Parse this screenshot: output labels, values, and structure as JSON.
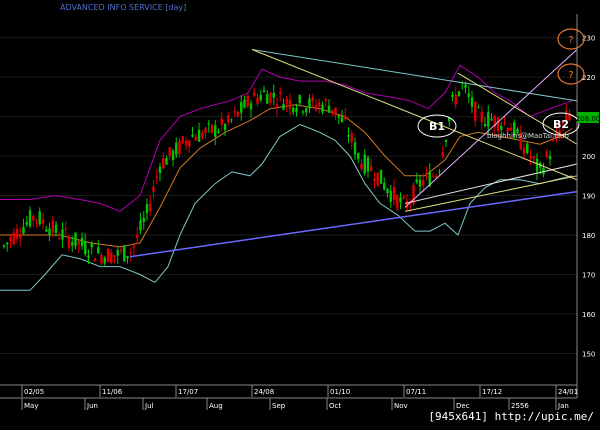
{
  "chart_data": {
    "type": "candlestick",
    "title": "ADVANCED INFO SERVICE [day]",
    "last_price_label": "208.00",
    "watermark": "bloghhihs@MaoTai.club",
    "y_ticks": [
      150,
      160,
      170,
      180,
      190,
      200,
      210,
      220,
      230
    ],
    "ylim": [
      142,
      236
    ],
    "date_ticks": [
      "02/05",
      "11/06",
      "17/07",
      "24/08",
      "01/10",
      "07/11",
      "17/12",
      "24/01"
    ],
    "month_ticks": [
      "May",
      "Jun",
      "Jul",
      "Aug",
      "Sep",
      "Oct",
      "Nov",
      "Dec",
      "2556",
      "Jan"
    ],
    "annotations": {
      "b1": "B1",
      "b2": "B2",
      "q1": "?",
      "q2": "?"
    },
    "colors": {
      "up": "#00c800",
      "down": "#e00000",
      "upper_band": "#b000b0",
      "lower_band": "#7fc8c8",
      "ma": "#d27828",
      "support": "#6a68ff",
      "tick_text": "#ffffff",
      "title_text": "#4f6fd0",
      "last_price_bg": "#00b000"
    }
  },
  "footer": {
    "tag": "[945x641] http://upic.me/"
  }
}
